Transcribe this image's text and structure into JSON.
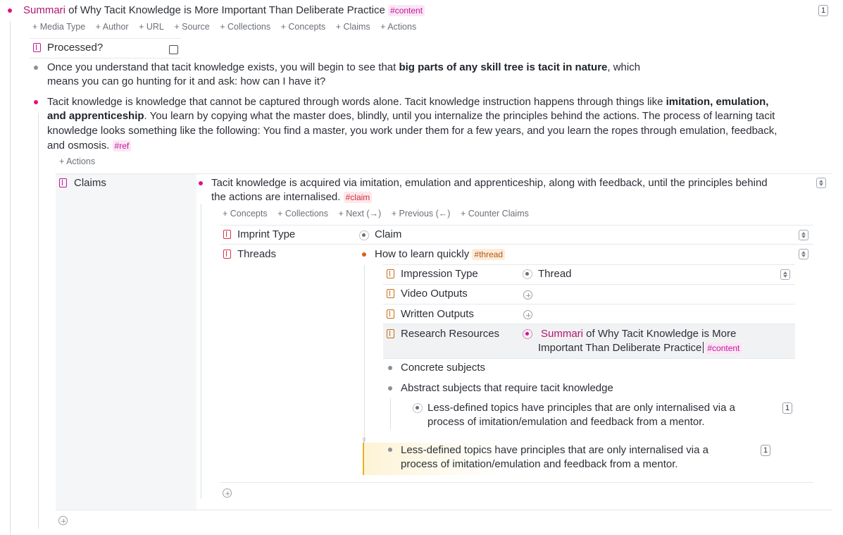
{
  "root": {
    "summari": "Summari",
    "title_rest": " of Why Tacit Knowledge is More Important Than Deliberate Practice ",
    "tag": "#content",
    "count": "1",
    "actions": [
      "+ Media Type",
      "+ Author",
      "+ URL",
      "+ Source",
      "+ Collections",
      "+ Concepts",
      "+ Claims",
      "+ Actions"
    ]
  },
  "processed": {
    "label": "Processed?"
  },
  "bullet1": {
    "line1_pre": "Once you understand that tacit knowledge exists, you will begin to see that ",
    "line1_bold": "big parts of any skill tree is tacit in nature",
    "line1_post": ", which",
    "line2": "means you can go hunting for it and ask: how can I have it?"
  },
  "bullet2": {
    "l1_pre": "Tacit knowledge is knowledge that cannot be captured through words alone. Tacit knowledge instruction happens through things like ",
    "l1_bold": "imitation, emulation,",
    "l2_bold": "and apprenticeship",
    "l2_post": ". You learn by copying what the master does, blindly, until you internalize the principles behind the actions. The process of learning tacit",
    "l3": "knowledge looks something like the following: You find a master, you work under them for a few years, and you learn the ropes through emulation, feedback,",
    "l4": "and osmosis. ",
    "tag": "#ref",
    "actions": "+ Actions"
  },
  "claims": {
    "label": "Claims",
    "claim_l1": "Tacit knowledge is acquired via imitation, emulation and apprenticeship, along with feedback, until the principles behind",
    "claim_l2": "the actions are internalised. ",
    "claim_tag": "#claim",
    "actions": [
      "+ Concepts",
      "+ Collections",
      "+ Next (→)",
      "+ Previous (←)",
      "+ Counter Claims"
    ],
    "imprint_type_label": "Imprint Type",
    "imprint_type_value": "Claim",
    "threads_label": "Threads",
    "thread_title": "How to learn quickly ",
    "thread_tag": "#thread",
    "impression_type_label": "Impression Type",
    "impression_type_value": "Thread",
    "video_outputs_label": "Video Outputs",
    "written_outputs_label": "Written Outputs",
    "research_resources_label": "Research Resources",
    "rr_summari": "Summari",
    "rr_l1_rest": " of Why Tacit Knowledge is More",
    "rr_l2": "Important Than Deliberate Practice",
    "rr_tag": "#content",
    "concrete": "Concrete subjects",
    "abstract": "Abstract subjects that require tacit knowledge",
    "sub_l1": "Less-defined topics have principles that are only internalised via a",
    "sub_l2": "process of imitation/emulation and feedback from a mentor.",
    "sub_count": "1",
    "drag_l1": "Less-defined topics have principles that are only internalised via a",
    "drag_l2": "process of imitation/emulation and feedback from a mentor.",
    "drag_count": "1"
  }
}
